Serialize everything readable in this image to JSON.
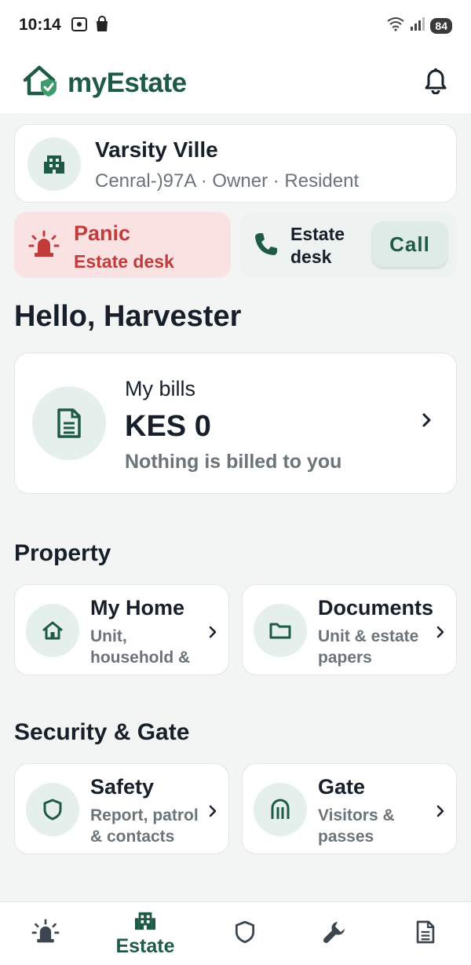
{
  "status_bar": {
    "time": "10:14",
    "battery": "84"
  },
  "header": {
    "brand": "myEstate"
  },
  "estate": {
    "name": "Varsity Ville",
    "details": "Cenral-)97A · Owner · Resident"
  },
  "panic": {
    "title": "Panic",
    "subtitle": "Estate desk"
  },
  "estate_desk": {
    "label": "Estate desk",
    "call_label": "Call"
  },
  "greeting": "Hello, Harvester",
  "bills": {
    "label": "My bills",
    "amount": "KES 0",
    "note": "Nothing is billed to you"
  },
  "property": {
    "title": "Property",
    "tiles": [
      {
        "title": "My Home",
        "subtitle": "Unit, household &"
      },
      {
        "title": "Documents",
        "subtitle": "Unit & estate papers"
      }
    ]
  },
  "security": {
    "title": "Security & Gate",
    "tiles": [
      {
        "title": "Safety",
        "subtitle": "Report, patrol & contacts"
      },
      {
        "title": "Gate",
        "subtitle": "Visitors & passes"
      }
    ]
  },
  "bottom_nav": {
    "active_label": "Estate",
    "items": [
      {
        "icon": "alarm-icon"
      },
      {
        "icon": "building-icon",
        "label": "Estate"
      },
      {
        "icon": "shield-icon"
      },
      {
        "icon": "wrench-icon"
      },
      {
        "icon": "document-icon"
      }
    ]
  },
  "colors": {
    "brand": "#1f5a48",
    "panic": "#c23b3b",
    "muted": "#6b7479",
    "icon_bg": "#e5efec"
  }
}
